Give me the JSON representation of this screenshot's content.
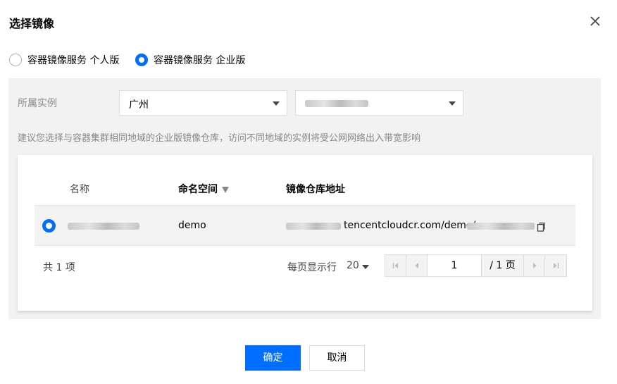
{
  "dialog": {
    "title": "选择镜像",
    "close_icon": "close-icon"
  },
  "edition": {
    "options": [
      {
        "label": "容器镜像服务 个人版",
        "selected": false
      },
      {
        "label": "容器镜像服务 企业版",
        "selected": true
      }
    ]
  },
  "instance": {
    "label": "所属实例",
    "region_value": "广州",
    "tip": "建议您选择与容器集群相同地域的企业版镜像仓库，访问不同地域的实例将受公网网络出入带宽影响"
  },
  "table": {
    "columns": [
      "名称",
      "命名空间",
      "镜像仓库地址"
    ],
    "rows": [
      {
        "selected": true,
        "namespace": "demo",
        "address_visible": "tencentcloudcr.com/demo/"
      }
    ]
  },
  "pagination": {
    "total": "共 1 项",
    "per_page_label": "每页显示行",
    "page_size": "20",
    "current_page": "1",
    "total_pages": "/ 1 页"
  },
  "footer": {
    "confirm_label": "确定",
    "cancel_label": "取消"
  },
  "colors": {
    "primary": "#006eff",
    "panel_bg": "#f2f2f2"
  }
}
